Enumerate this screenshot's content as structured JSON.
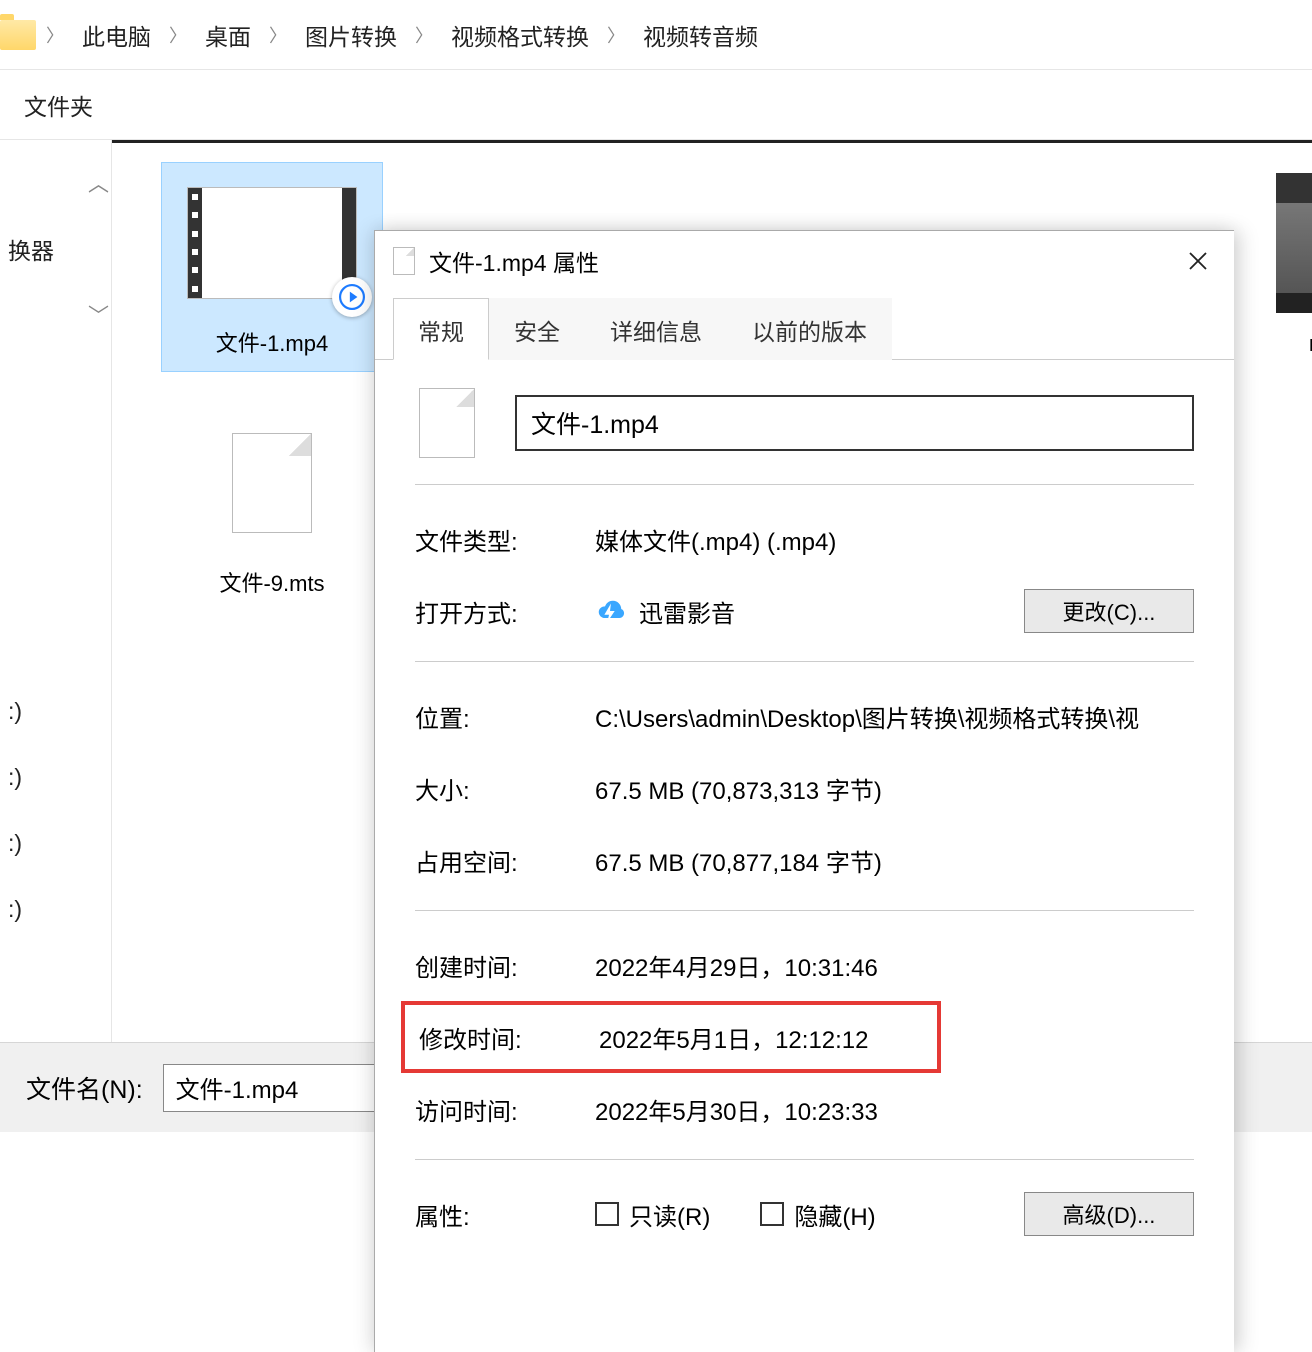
{
  "breadcrumb": {
    "items": [
      "此电脑",
      "桌面",
      "图片转换",
      "视频格式转换",
      "视频转音频"
    ]
  },
  "toolbar": {
    "newfolder": "文件夹"
  },
  "nav": {
    "node1": "换器",
    "suffixes": [
      ":)",
      ":)",
      ":)",
      ":)"
    ]
  },
  "files": {
    "f1": {
      "name": "文件-1.mp4"
    },
    "f2": {
      "name": "文件-9.mts"
    },
    "f3": {
      "name": "nkv"
    }
  },
  "openbar": {
    "label": "文件名(N):",
    "value": "文件-1.mp4"
  },
  "dialog": {
    "title": "文件-1.mp4 属性",
    "tabs": {
      "general": "常规",
      "security": "安全",
      "details": "详细信息",
      "prev": "以前的版本"
    },
    "filename": "文件-1.mp4",
    "rows": {
      "type_k": "文件类型:",
      "type_v": "媒体文件(.mp4) (.mp4)",
      "open_k": "打开方式:",
      "open_v": "迅雷影音",
      "change": "更改(C)...",
      "loc_k": "位置:",
      "loc_v": "C:\\Users\\admin\\Desktop\\图片转换\\视频格式转换\\视",
      "size_k": "大小:",
      "size_v": "67.5 MB (70,873,313 字节)",
      "disk_k": "占用空间:",
      "disk_v": "67.5 MB (70,877,184 字节)",
      "ctime_k": "创建时间:",
      "ctime_v": "2022年4月29日，10:31:46",
      "mtime_k": "修改时间:",
      "mtime_v": "2022年5月1日，12:12:12",
      "atime_k": "访问时间:",
      "atime_v": "2022年5月30日，10:23:33",
      "attr_k": "属性:",
      "readonly": "只读(R)",
      "hidden": "隐藏(H)",
      "advanced": "高级(D)..."
    }
  }
}
